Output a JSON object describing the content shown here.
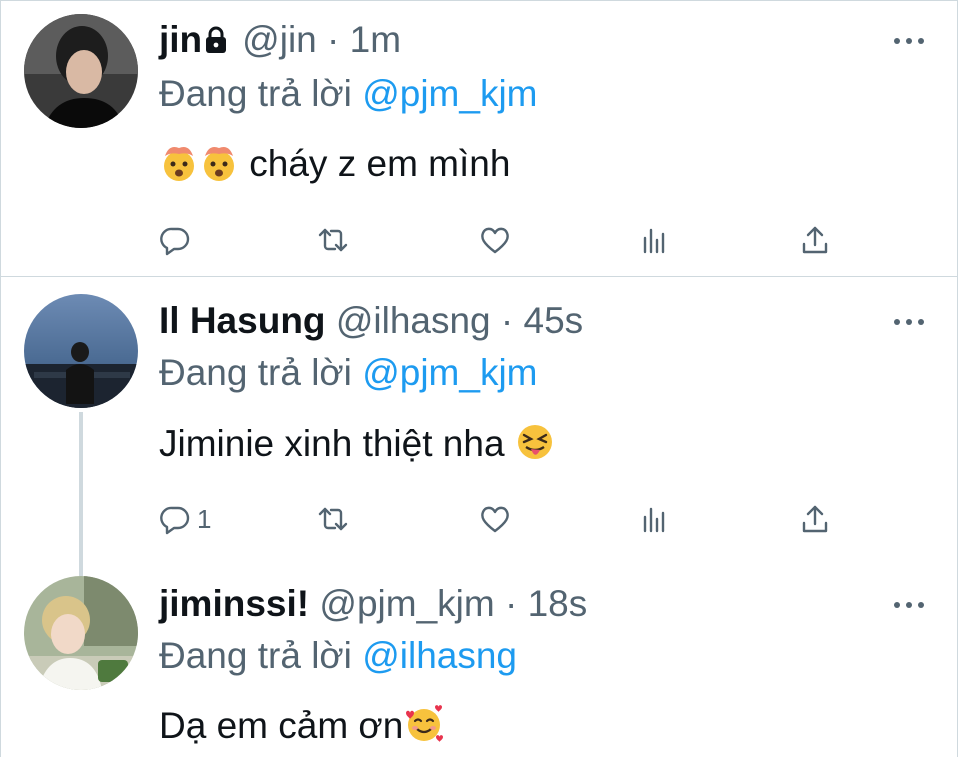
{
  "tweets": [
    {
      "name": "jin",
      "handle": "@jin",
      "separator": "·",
      "time": "1m",
      "reply_prefix": "Đang trả lời",
      "reply_to": "@pjm_kjm",
      "text": "cháy z em mình",
      "reply_count": "",
      "locked": true
    },
    {
      "name": "Il Hasung",
      "handle": "@ilhasng",
      "separator": "·",
      "time": "45s",
      "reply_prefix": "Đang trả lời",
      "reply_to": "@pjm_kjm",
      "text": "Jiminie xinh thiệt nha",
      "reply_count": "1",
      "locked": false
    },
    {
      "name": "jiminssi!",
      "handle": "@pjm_kjm",
      "separator": "·",
      "time": "18s",
      "reply_prefix": "Đang trả lời",
      "reply_to": "@ilhasng",
      "text": "Dạ em cảm ơn",
      "locked": false
    }
  ],
  "icons": [
    "lock-icon",
    "more-icon",
    "reply-icon",
    "retweet-icon",
    "like-icon",
    "analytics-icon",
    "share-icon",
    "exploding-head-emoji",
    "squinting-tongue-emoji",
    "smiling-hearts-emoji"
  ],
  "colors": {
    "accent": "#1d9bf0",
    "text": "#0f1419",
    "secondary": "#536471",
    "border": "#cfd9de"
  }
}
